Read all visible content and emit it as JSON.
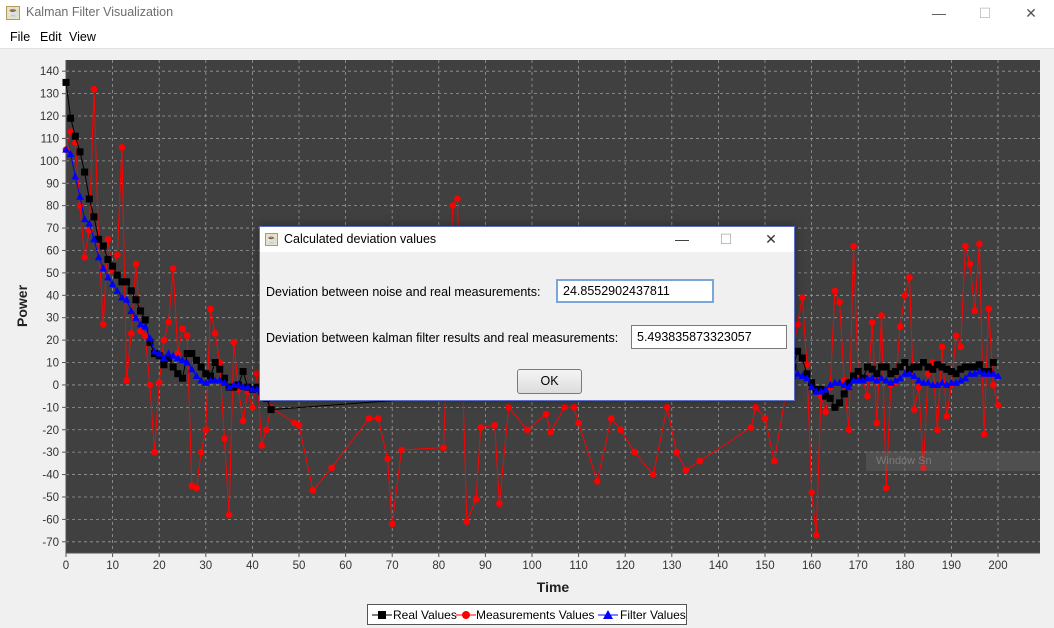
{
  "window": {
    "title": "Kalman Filter Visualization",
    "controls": {
      "minimize": "—",
      "maximize": "☐",
      "close": "✕"
    }
  },
  "menu": {
    "items": [
      "File",
      "Edit",
      "View"
    ]
  },
  "chart_data": {
    "type": "line",
    "xlabel": "Time",
    "ylabel": "Power",
    "xlim": [
      0,
      200
    ],
    "ylim": [
      -75,
      145
    ],
    "x_ticks": [
      0,
      10,
      20,
      30,
      40,
      50,
      60,
      70,
      80,
      90,
      100,
      110,
      120,
      130,
      140,
      150,
      160,
      170,
      180,
      190,
      200
    ],
    "y_ticks": [
      140,
      130,
      120,
      110,
      100,
      90,
      80,
      70,
      60,
      50,
      40,
      30,
      20,
      10,
      0,
      -10,
      -20,
      -30,
      -40,
      -50,
      -60,
      -70
    ],
    "grid": true,
    "background": "#404040",
    "legend": "bottom-center",
    "series": [
      {
        "name": "Real Values",
        "color": "#000000",
        "marker": "square",
        "points": [
          [
            0,
            135
          ],
          [
            1,
            119
          ],
          [
            2,
            111
          ],
          [
            3,
            104
          ],
          [
            4,
            95
          ],
          [
            5,
            83
          ],
          [
            6,
            75
          ],
          [
            7,
            65
          ],
          [
            8,
            62
          ],
          [
            9,
            56
          ],
          [
            10,
            53
          ],
          [
            11,
            49
          ],
          [
            12,
            46
          ],
          [
            13,
            46
          ],
          [
            14,
            42
          ],
          [
            15,
            38
          ],
          [
            16,
            33
          ],
          [
            17,
            29
          ],
          [
            18,
            19
          ],
          [
            19,
            14
          ],
          [
            20,
            13
          ],
          [
            21,
            9
          ],
          [
            22,
            12
          ],
          [
            23,
            8
          ],
          [
            24,
            5
          ],
          [
            25,
            3
          ],
          [
            26,
            14
          ],
          [
            27,
            14
          ],
          [
            28,
            11
          ],
          [
            29,
            8
          ],
          [
            30,
            5
          ],
          [
            31,
            4
          ],
          [
            32,
            10
          ],
          [
            33,
            7
          ],
          [
            34,
            3
          ],
          [
            35,
            -1
          ],
          [
            36,
            -1
          ],
          [
            37,
            0
          ],
          [
            38,
            6
          ],
          [
            39,
            -1
          ],
          [
            40,
            -2
          ],
          [
            41,
            -1
          ],
          [
            42,
            -3
          ],
          [
            43,
            -6
          ],
          [
            44,
            -11
          ],
          [
            155,
            6
          ],
          [
            156,
            8
          ],
          [
            157,
            15
          ],
          [
            158,
            12
          ],
          [
            159,
            5
          ],
          [
            160,
            1
          ],
          [
            161,
            -2
          ],
          [
            162,
            -2
          ],
          [
            163,
            -5
          ],
          [
            164,
            -6
          ],
          [
            165,
            -10
          ],
          [
            166,
            -8
          ],
          [
            167,
            -4
          ],
          [
            168,
            1
          ],
          [
            169,
            4
          ],
          [
            170,
            6
          ],
          [
            171,
            3
          ],
          [
            172,
            8
          ],
          [
            173,
            7
          ],
          [
            174,
            5
          ],
          [
            175,
            8
          ],
          [
            176,
            8
          ],
          [
            177,
            5
          ],
          [
            178,
            6
          ],
          [
            179,
            8
          ],
          [
            180,
            10
          ],
          [
            181,
            7
          ],
          [
            182,
            8
          ],
          [
            183,
            8
          ],
          [
            184,
            10
          ],
          [
            185,
            8
          ],
          [
            186,
            7
          ],
          [
            187,
            9
          ],
          [
            188,
            8
          ],
          [
            189,
            7
          ],
          [
            190,
            6
          ],
          [
            191,
            5
          ],
          [
            192,
            7
          ],
          [
            193,
            8
          ],
          [
            194,
            8
          ],
          [
            195,
            8
          ],
          [
            196,
            9
          ],
          [
            197,
            6
          ],
          [
            198,
            6
          ],
          [
            199,
            10
          ]
        ]
      },
      {
        "name": "Measurements Values",
        "color": "#ff0000",
        "marker": "circle",
        "points": [
          [
            0,
            105
          ],
          [
            1,
            113
          ],
          [
            2,
            108
          ],
          [
            3,
            80
          ],
          [
            4,
            57
          ],
          [
            5,
            69
          ],
          [
            6,
            132
          ],
          [
            7,
            64
          ],
          [
            8,
            27
          ],
          [
            9,
            65
          ],
          [
            10,
            51
          ],
          [
            11,
            58
          ],
          [
            12,
            106
          ],
          [
            13,
            2
          ],
          [
            14,
            23
          ],
          [
            15,
            54
          ],
          [
            16,
            24
          ],
          [
            17,
            22
          ],
          [
            18,
            0
          ],
          [
            19,
            -30
          ],
          [
            20,
            1
          ],
          [
            21,
            20
          ],
          [
            22,
            28
          ],
          [
            23,
            52
          ],
          [
            24,
            14
          ],
          [
            25,
            25
          ],
          [
            26,
            22
          ],
          [
            27,
            -45
          ],
          [
            28,
            -46
          ],
          [
            29,
            -30
          ],
          [
            30,
            -20
          ],
          [
            31,
            34
          ],
          [
            32,
            23
          ],
          [
            33,
            10
          ],
          [
            34,
            -24
          ],
          [
            35,
            -58
          ],
          [
            36,
            19
          ],
          [
            37,
            -2
          ],
          [
            38,
            -16
          ],
          [
            39,
            -3
          ],
          [
            40,
            -10
          ],
          [
            41,
            5
          ],
          [
            42,
            -27
          ],
          [
            43,
            -20
          ],
          [
            44,
            -10
          ],
          [
            49,
            -17
          ],
          [
            50,
            -18
          ],
          [
            53,
            -47
          ],
          [
            57,
            -37
          ],
          [
            65,
            -15
          ],
          [
            67,
            -15
          ],
          [
            69,
            -33
          ],
          [
            70,
            -62
          ],
          [
            72,
            -29
          ],
          [
            81,
            -28
          ],
          [
            83,
            80
          ],
          [
            84,
            83
          ],
          [
            86,
            -61
          ],
          [
            88,
            -51
          ],
          [
            89,
            -19
          ],
          [
            92,
            -18
          ],
          [
            93,
            -53
          ],
          [
            95,
            -10
          ],
          [
            99,
            -20
          ],
          [
            103,
            -13
          ],
          [
            104,
            -21
          ],
          [
            107,
            -10
          ],
          [
            109,
            -10
          ],
          [
            110,
            -17
          ],
          [
            114,
            -43
          ],
          [
            117,
            -15
          ],
          [
            119,
            -20
          ],
          [
            122,
            -30
          ],
          [
            126,
            -40
          ],
          [
            129,
            -10
          ],
          [
            131,
            -30
          ],
          [
            133,
            -38
          ],
          [
            136,
            -34
          ],
          [
            147,
            -19
          ],
          [
            148,
            -10
          ],
          [
            150,
            -15
          ],
          [
            152,
            -34
          ],
          [
            157,
            27
          ],
          [
            158,
            39
          ],
          [
            159,
            9
          ],
          [
            160,
            -48
          ],
          [
            161,
            -67
          ],
          [
            162,
            -5
          ],
          [
            163,
            -12
          ],
          [
            164,
            -1
          ],
          [
            165,
            42
          ],
          [
            166,
            37
          ],
          [
            167,
            2
          ],
          [
            168,
            -20
          ],
          [
            169,
            62
          ],
          [
            170,
            5
          ],
          [
            171,
            2
          ],
          [
            172,
            -5
          ],
          [
            173,
            28
          ],
          [
            174,
            -17
          ],
          [
            175,
            31
          ],
          [
            176,
            -46
          ],
          [
            177,
            0
          ],
          [
            178,
            1
          ],
          [
            179,
            26
          ],
          [
            180,
            40
          ],
          [
            181,
            48
          ],
          [
            182,
            -11
          ],
          [
            183,
            -1
          ],
          [
            184,
            -37
          ],
          [
            185,
            5
          ],
          [
            186,
            10
          ],
          [
            187,
            -20
          ],
          [
            188,
            17
          ],
          [
            189,
            -14
          ],
          [
            190,
            0
          ],
          [
            191,
            22
          ],
          [
            192,
            17
          ],
          [
            193,
            62
          ],
          [
            194,
            54
          ],
          [
            195,
            33
          ],
          [
            196,
            63
          ],
          [
            197,
            -22
          ],
          [
            198,
            34
          ],
          [
            199,
            0
          ],
          [
            200,
            -9
          ]
        ]
      },
      {
        "name": "Filter Values",
        "color": "#0000ff",
        "marker": "triangle",
        "points": [
          [
            0,
            105
          ],
          [
            1,
            103
          ],
          [
            2,
            93
          ],
          [
            3,
            84
          ],
          [
            4,
            74
          ],
          [
            5,
            72
          ],
          [
            6,
            65
          ],
          [
            7,
            57
          ],
          [
            8,
            52
          ],
          [
            9,
            48
          ],
          [
            10,
            45
          ],
          [
            11,
            42
          ],
          [
            12,
            39
          ],
          [
            13,
            38
          ],
          [
            14,
            33
          ],
          [
            15,
            30
          ],
          [
            16,
            27
          ],
          [
            17,
            26
          ],
          [
            18,
            21
          ],
          [
            19,
            15
          ],
          [
            20,
            14
          ],
          [
            21,
            12
          ],
          [
            22,
            14
          ],
          [
            23,
            13
          ],
          [
            24,
            12
          ],
          [
            25,
            11
          ],
          [
            26,
            10
          ],
          [
            27,
            7
          ],
          [
            28,
            4
          ],
          [
            29,
            2
          ],
          [
            30,
            1
          ],
          [
            31,
            2
          ],
          [
            32,
            2
          ],
          [
            33,
            2
          ],
          [
            34,
            1
          ],
          [
            35,
            -1
          ],
          [
            36,
            0
          ],
          [
            37,
            0
          ],
          [
            38,
            -1
          ],
          [
            39,
            -1
          ],
          [
            40,
            -2
          ],
          [
            41,
            -2
          ],
          [
            42,
            -3
          ],
          [
            155,
            5
          ],
          [
            156,
            4
          ],
          [
            157,
            5
          ],
          [
            158,
            4
          ],
          [
            159,
            3
          ],
          [
            160,
            -1
          ],
          [
            161,
            -3
          ],
          [
            162,
            -3
          ],
          [
            163,
            -2
          ],
          [
            164,
            0
          ],
          [
            165,
            1
          ],
          [
            166,
            1
          ],
          [
            167,
            0
          ],
          [
            168,
            -1
          ],
          [
            169,
            2
          ],
          [
            170,
            2
          ],
          [
            171,
            2
          ],
          [
            172,
            3
          ],
          [
            173,
            3
          ],
          [
            174,
            2
          ],
          [
            175,
            3
          ],
          [
            176,
            2
          ],
          [
            177,
            1
          ],
          [
            178,
            2
          ],
          [
            179,
            3
          ],
          [
            180,
            5
          ],
          [
            181,
            5
          ],
          [
            182,
            4
          ],
          [
            183,
            2
          ],
          [
            184,
            1
          ],
          [
            185,
            1
          ],
          [
            186,
            0
          ],
          [
            187,
            0
          ],
          [
            188,
            1
          ],
          [
            189,
            0
          ],
          [
            190,
            1
          ],
          [
            191,
            1
          ],
          [
            192,
            2
          ],
          [
            193,
            3
          ],
          [
            194,
            5
          ],
          [
            195,
            5
          ],
          [
            196,
            6
          ],
          [
            197,
            5
          ],
          [
            198,
            5
          ],
          [
            199,
            5
          ],
          [
            200,
            4
          ]
        ]
      }
    ]
  },
  "legend": {
    "items": [
      "Real Values",
      "Measurements Values",
      "Filter Values"
    ]
  },
  "watermark": {
    "text": "Window Sn"
  },
  "dialog": {
    "title": "Calculated deviation values",
    "controls": {
      "minimize": "—",
      "maximize": "☐",
      "close": "✕"
    },
    "noise_label": "Deviation between noise and real measurements:",
    "noise_value": "24.8552902437811",
    "kalman_label": "Deviation between kalman filter results and real measurements:",
    "kalman_value": "5.493835873323057",
    "ok_label": "OK"
  }
}
